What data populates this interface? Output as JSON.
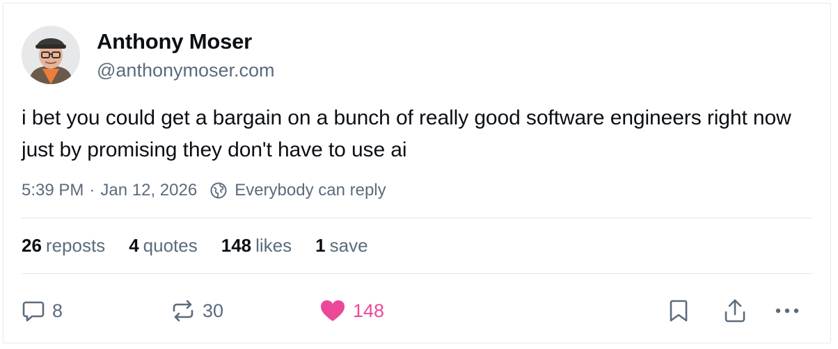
{
  "post": {
    "author": {
      "display_name": "Anthony Moser",
      "handle": "@anthonymoser.com",
      "avatar_icon": "avatar-photo"
    },
    "text": "i bet you could get a bargain on a bunch of really good software engineers right now just by promising they don't have to use ai",
    "time": "5:39 PM",
    "separator": "·",
    "date": "Jan 12, 2026",
    "reply_setting": "Everybody can reply",
    "stats": [
      {
        "count": "26",
        "label": "reposts"
      },
      {
        "count": "4",
        "label": "quotes"
      },
      {
        "count": "148",
        "label": "likes"
      },
      {
        "count": "1",
        "label": "save"
      }
    ],
    "actions": {
      "reply": {
        "icon": "speech-bubble-icon",
        "count": "8"
      },
      "repost": {
        "icon": "repost-icon",
        "count": "30"
      },
      "like": {
        "icon": "heart-icon",
        "count": "148",
        "active": true,
        "color": "#ec4899"
      },
      "bookmark": {
        "icon": "bookmark-icon"
      },
      "share": {
        "icon": "share-icon"
      },
      "more": {
        "icon": "ellipsis-icon"
      }
    }
  },
  "colors": {
    "text_primary": "#0b0f14",
    "text_secondary": "#5b6b7c",
    "like_active": "#ec4899",
    "divider": "#e3e6ea"
  }
}
